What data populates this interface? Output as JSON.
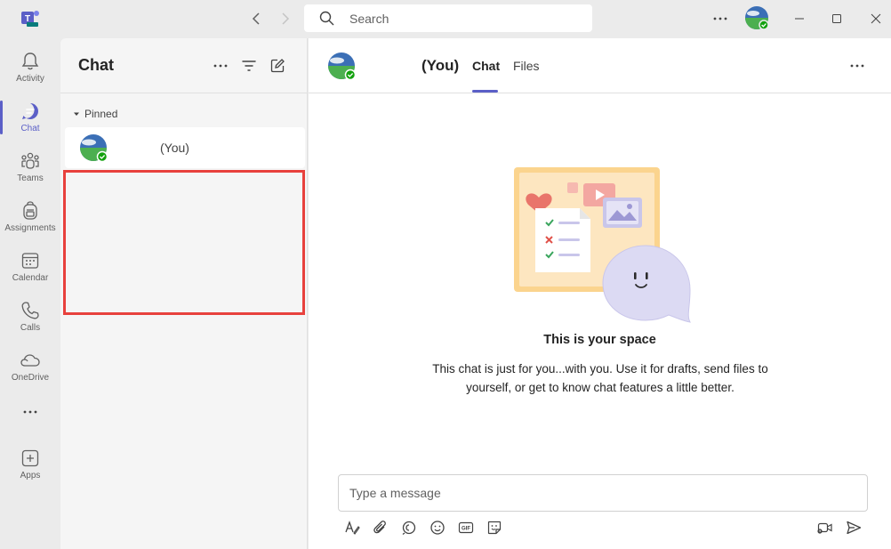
{
  "titlebar": {
    "search_placeholder": "Search"
  },
  "rail": {
    "items": [
      {
        "label": "Activity",
        "icon": "bell-icon"
      },
      {
        "label": "Chat",
        "icon": "chat-icon",
        "active": true
      },
      {
        "label": "Teams",
        "icon": "teams-icon"
      },
      {
        "label": "Assignments",
        "icon": "backpack-icon"
      },
      {
        "label": "Calendar",
        "icon": "calendar-icon"
      },
      {
        "label": "Calls",
        "icon": "phone-icon"
      },
      {
        "label": "OneDrive",
        "icon": "cloud-icon"
      }
    ],
    "apps_label": "Apps"
  },
  "chatlist": {
    "title": "Chat",
    "pinned_label": "Pinned",
    "items": [
      {
        "name": "(You)"
      }
    ]
  },
  "main": {
    "title": "(You)",
    "tabs": [
      {
        "label": "Chat",
        "active": true
      },
      {
        "label": "Files"
      }
    ],
    "space_title": "This is your space",
    "space_desc": "This chat is just for you...with you. Use it for drafts, send files to yourself, or get to know chat features a little better.",
    "compose_placeholder": "Type a message"
  },
  "colors": {
    "accent": "#5b5fc7",
    "highlight_box": "#e8413d",
    "presence_available": "#13a10e"
  }
}
